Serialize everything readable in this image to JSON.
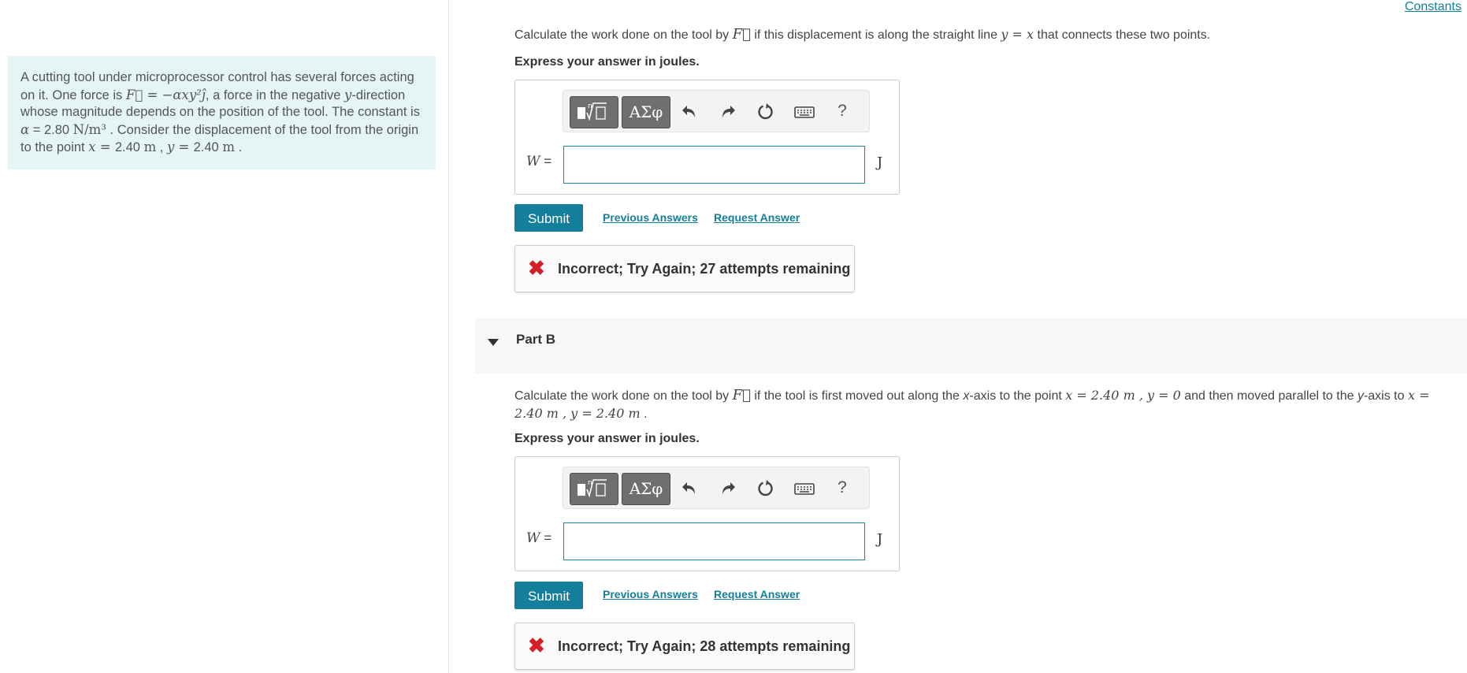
{
  "header": {
    "constants_link": "Constants"
  },
  "problem": {
    "t1": "A cutting tool under microprocessor control has several forces acting on it. One force is ",
    "F_eq": "F⃗ = −αxy²ĵ",
    "t2": ", a force in the negative ",
    "y": "y",
    "t3": "-direction whose magnitude depends on the position of the tool. The constant is ",
    "alpha": "α",
    "alpha_value": " = 2.80 ",
    "alpha_unit": "N/m³",
    "t4": " . Consider the displacement of the tool from the origin to the point ",
    "x_eq": "x = ",
    "x_value": "2.40 ",
    "x_unit": "m",
    "sep": " , ",
    "y_eq": "y = ",
    "y_value": "2.40 ",
    "y_unit": "m",
    "end": " ."
  },
  "part_a": {
    "q1": "Calculate the work done on the tool by ",
    "F": "F⃗",
    "q2": " if this displacement is along the straight line ",
    "line_eq": "y = x",
    "q3": " that connects these two points.",
    "express": "Express your answer in joules.",
    "var": "W",
    "eq": " =",
    "input_value": "",
    "unit": "J",
    "submit": "Submit",
    "prev": "Previous Answers",
    "request": "Request Answer",
    "feedback": "Incorrect; Try Again; 27 attempts remaining"
  },
  "part_b": {
    "title": "Part B",
    "q1": "Calculate the work done on the tool by ",
    "F": "F⃗",
    "q2": " if the tool is first moved out along the ",
    "x_axis": "x",
    "q3": "-axis to the point ",
    "pt1": "x = 2.40 m , y = 0",
    "q4": " and then moved parallel to the ",
    "y_axis": "y",
    "q5": "-axis to ",
    "pt2": "x = 2.40 m , y = 2.40 m",
    "q6": " .",
    "express": "Express your answer in joules.",
    "var": "W",
    "eq": " =",
    "input_value": "",
    "unit": "J",
    "submit": "Submit",
    "prev": "Previous Answers",
    "request": "Request Answer",
    "feedback": "Incorrect; Try Again; 28 attempts remaining"
  },
  "toolbar": {
    "greek": "ΑΣφ",
    "help": "?"
  },
  "colors": {
    "accent": "#137f9b",
    "problem_bg": "#e5f5f5",
    "error": "#d41f26"
  }
}
